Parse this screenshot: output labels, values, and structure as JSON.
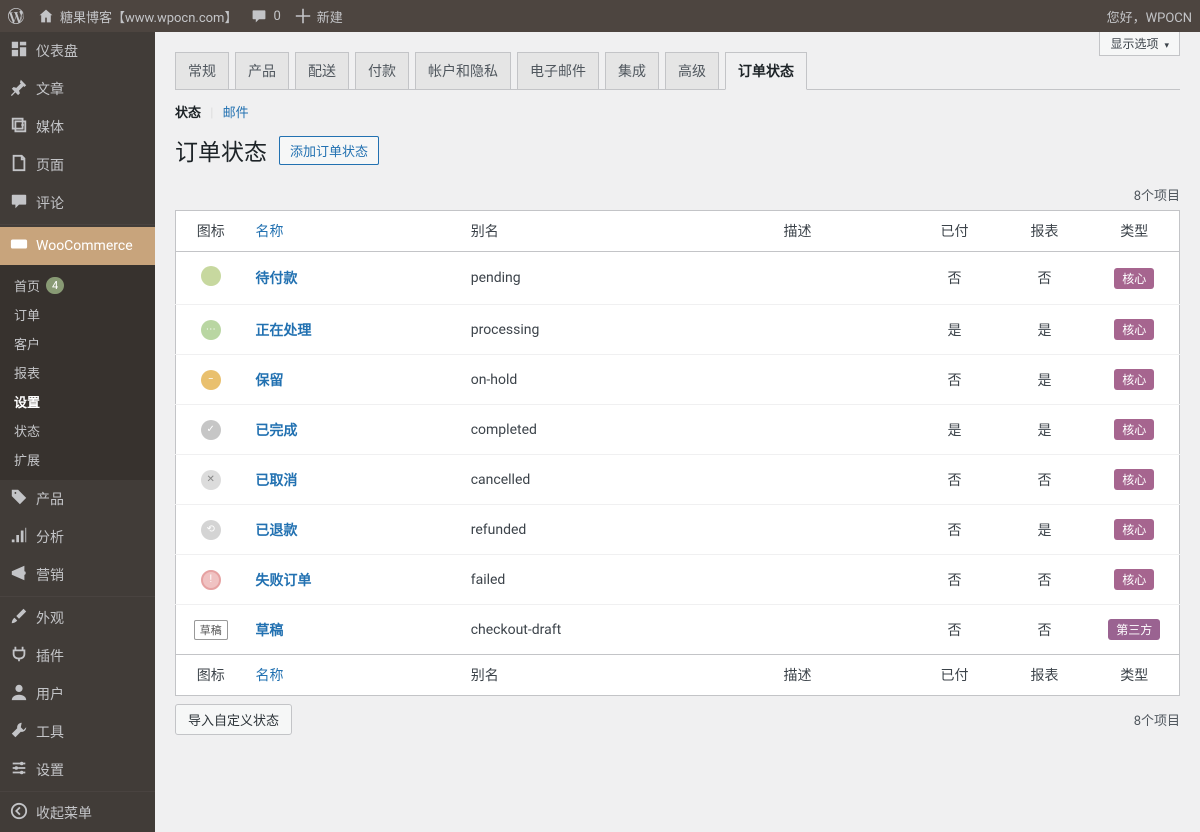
{
  "adminBar": {
    "siteTitle": "糖果博客【www.wpocn.com】",
    "comments": "0",
    "newLabel": "新建",
    "greeting": "您好，WPOCN"
  },
  "screenOptions": "显示选项",
  "sidebar": {
    "items": [
      {
        "label": "仪表盘",
        "icon": "dashboard"
      },
      {
        "label": "文章",
        "icon": "pin"
      },
      {
        "label": "媒体",
        "icon": "media"
      },
      {
        "label": "页面",
        "icon": "page"
      },
      {
        "label": "评论",
        "icon": "comment"
      },
      {
        "label": "WooCommerce",
        "icon": "woo",
        "active": true
      },
      {
        "label": "产品",
        "icon": "product"
      },
      {
        "label": "分析",
        "icon": "analytics"
      },
      {
        "label": "营销",
        "icon": "marketing"
      },
      {
        "label": "外观",
        "icon": "brush"
      },
      {
        "label": "插件",
        "icon": "plugin"
      },
      {
        "label": "用户",
        "icon": "user"
      },
      {
        "label": "工具",
        "icon": "tool"
      },
      {
        "label": "设置",
        "icon": "settings"
      }
    ],
    "collapse": "收起菜单",
    "submenu": {
      "home": "首页",
      "homeCount": "4",
      "orders": "订单",
      "customers": "客户",
      "reports": "报表",
      "settings": "设置",
      "status": "状态",
      "ext": "扩展"
    }
  },
  "tabs": [
    "常规",
    "产品",
    "配送",
    "付款",
    "帐户和隐私",
    "电子邮件",
    "集成",
    "高级",
    "订单状态"
  ],
  "activeTab": 8,
  "subsections": {
    "status": "状态",
    "email": "邮件"
  },
  "heading": "订单状态",
  "addButton": "添加订单状态",
  "itemCount": "8个项目",
  "columns": {
    "icon": "图标",
    "name": "名称",
    "slug": "别名",
    "desc": "描述",
    "paid": "已付",
    "report": "报表",
    "type": "类型"
  },
  "yes": "是",
  "no": "否",
  "typeCore": "核心",
  "typeThird": "第三方",
  "rows": [
    {
      "iconClass": "ic-clock",
      "iconText": "",
      "name": "待付款",
      "slug": "pending",
      "desc": "",
      "paid": "no",
      "report": "no",
      "type": "core"
    },
    {
      "iconClass": "ic-proc",
      "iconText": "⋯",
      "name": "正在处理",
      "slug": "processing",
      "desc": "",
      "paid": "yes",
      "report": "yes",
      "type": "core"
    },
    {
      "iconClass": "ic-hold",
      "iconText": "−",
      "name": "保留",
      "slug": "on-hold",
      "desc": "",
      "paid": "no",
      "report": "yes",
      "type": "core"
    },
    {
      "iconClass": "ic-done",
      "iconText": "✓",
      "name": "已完成",
      "slug": "completed",
      "desc": "",
      "paid": "yes",
      "report": "yes",
      "type": "core"
    },
    {
      "iconClass": "ic-cancel",
      "iconText": "✕",
      "name": "已取消",
      "slug": "cancelled",
      "desc": "",
      "paid": "no",
      "report": "no",
      "type": "core"
    },
    {
      "iconClass": "ic-refund",
      "iconText": "⟲",
      "name": "已退款",
      "slug": "refunded",
      "desc": "",
      "paid": "no",
      "report": "yes",
      "type": "core"
    },
    {
      "iconClass": "ic-failed",
      "iconText": "!",
      "name": "失败订单",
      "slug": "failed",
      "desc": "",
      "paid": "no",
      "report": "no",
      "type": "core"
    },
    {
      "iconClass": "ic-draft",
      "iconText": "草稿",
      "isDraft": true,
      "name": "草稿",
      "slug": "checkout-draft",
      "desc": "",
      "paid": "no",
      "report": "no",
      "type": "third"
    }
  ],
  "importBtn": "导入自定义状态"
}
